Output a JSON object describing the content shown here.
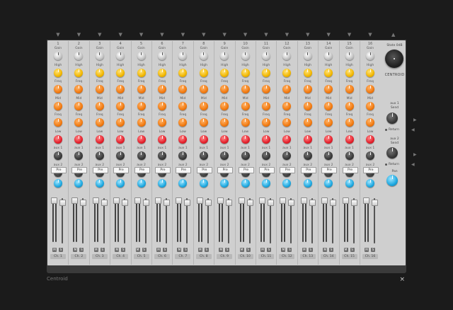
{
  "window_title": "Centroid",
  "close_glyph": "×",
  "colors": {
    "eq_high": "#f2b700",
    "eq_freq": "#f27a10",
    "eq_low": "#e5202c",
    "aux": "#3a3a3a",
    "pan": "#1ea8e0",
    "panel": "#cfcfcf"
  },
  "strip_labels": {
    "gain": "Gain",
    "high": "High",
    "freq": "Freq",
    "mid": "Mid",
    "freq2": "Freq",
    "low": "Low",
    "aux1": "aux 1",
    "aux2": "aux 2",
    "pre": "Pre",
    "pan": "Pan",
    "mute": "M",
    "solo": "S"
  },
  "channels": [
    {
      "number": "1",
      "name": "Ch. 1"
    },
    {
      "number": "2",
      "name": "Ch. 2"
    },
    {
      "number": "3",
      "name": "Ch. 3"
    },
    {
      "number": "4",
      "name": "Ch. 4"
    },
    {
      "number": "5",
      "name": "Ch. 5"
    },
    {
      "number": "6",
      "name": "Ch. 6"
    },
    {
      "number": "7",
      "name": "Ch. 7"
    },
    {
      "number": "8",
      "name": "Ch. 8"
    },
    {
      "number": "9",
      "name": "Ch. 9"
    },
    {
      "number": "10",
      "name": "Ch. 10"
    },
    {
      "number": "11",
      "name": "Ch. 11"
    },
    {
      "number": "12",
      "name": "Ch. 12"
    },
    {
      "number": "13",
      "name": "Ch. 13"
    },
    {
      "number": "14",
      "name": "Ch. 14"
    },
    {
      "number": "15",
      "name": "Ch. 15"
    },
    {
      "number": "16",
      "name": "Ch. 16"
    }
  ],
  "master": {
    "state_label": "State 0dB",
    "brand": "CENTROID",
    "aux1_label": "aux 1",
    "aux1_sub": "Send",
    "aux1_return": "Return",
    "aux2_label": "aux 2",
    "aux2_sub": "Send",
    "aux2_return": "Return",
    "pan_label": "Pan"
  },
  "icons": {
    "input_arrow": "arrow-down-icon",
    "output_arrow": "arrow-up-icon",
    "send_arrow": "arrow-right-icon",
    "return_arrow": "arrow-left-icon"
  }
}
